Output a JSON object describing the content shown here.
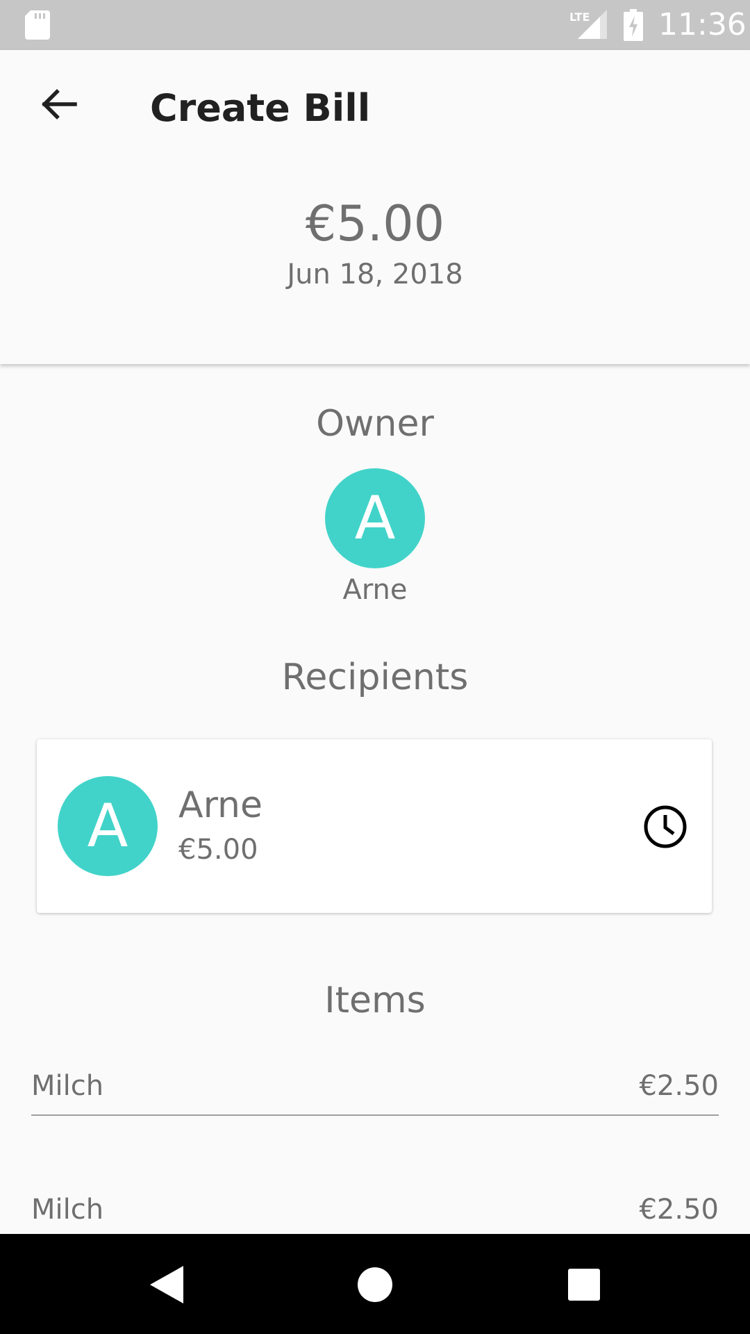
{
  "status_bar": {
    "time": "11:36",
    "network": "LTE",
    "icons": [
      "sd-card-icon",
      "signal-icon",
      "battery-charging-icon"
    ]
  },
  "header": {
    "title": "Create Bill",
    "back_icon": "arrow-left-icon",
    "total": "€5.00",
    "date": "Jun 18, 2018"
  },
  "owner": {
    "title": "Owner",
    "initial": "A",
    "name": "Arne",
    "avatar_color": "#41d3c9"
  },
  "recipients": {
    "title": "Recipients",
    "items": [
      {
        "initial": "A",
        "name": "Arne",
        "amount": "€5.00",
        "status_icon": "clock-icon"
      }
    ]
  },
  "items": {
    "title": "Items",
    "rows": [
      {
        "name": "Milch",
        "price": "€2.50"
      },
      {
        "name": "Milch",
        "price": "€2.50"
      }
    ]
  },
  "nav_bar": {
    "buttons": [
      "back-triangle-icon",
      "home-circle-icon",
      "recents-square-icon"
    ]
  },
  "colors": {
    "status_bar": "#c6c6c6",
    "background": "#fafafa",
    "accent": "#41d3c9",
    "text_primary": "#212121",
    "text_secondary": "#6f6f6f"
  }
}
